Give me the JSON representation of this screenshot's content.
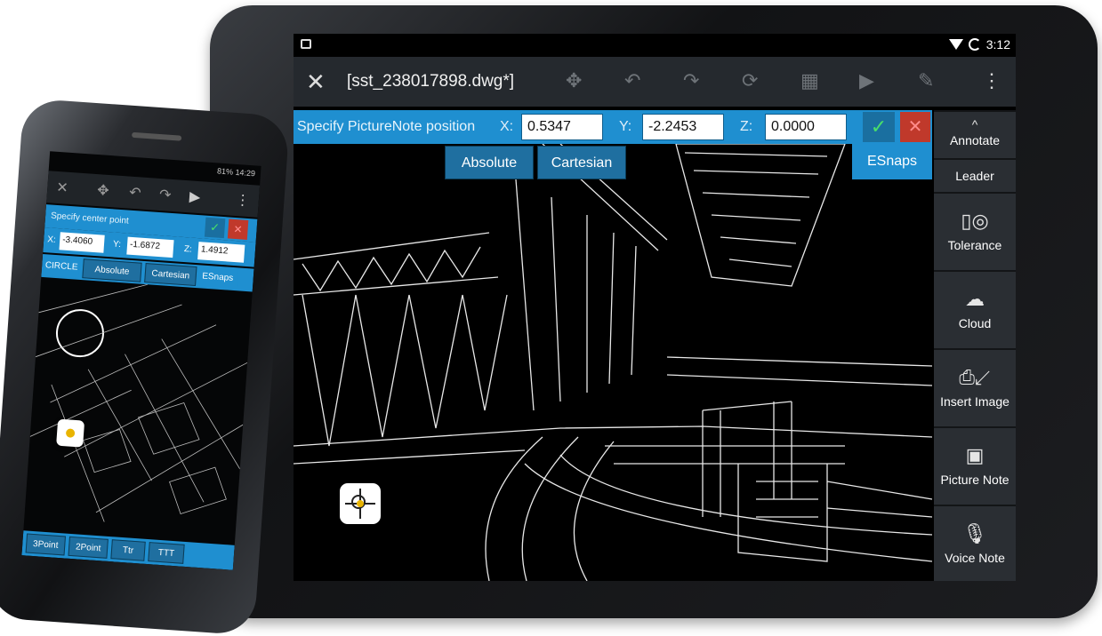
{
  "tablet": {
    "title": "[sst_238017898.dwg*]",
    "time": "3:12",
    "command_prompt": "Specify PictureNote position",
    "coords": {
      "x_label": "X:",
      "x": "0.5347",
      "y_label": "Y:",
      "y": "-2.2453",
      "z_label": "Z:",
      "z": "0.0000"
    },
    "modes": {
      "absolute": "Absolute",
      "cartesian": "Cartesian",
      "esnaps": "ESnaps"
    },
    "side_panel": [
      {
        "label": "Annotate",
        "icon": "chevron-up-icon"
      },
      {
        "label": "Leader",
        "icon": ""
      },
      {
        "label": "Tolerance",
        "icon": "tolerance-icon"
      },
      {
        "label": "Cloud",
        "icon": "cloud-icon"
      },
      {
        "label": "Insert Image",
        "icon": "insert-image-icon"
      },
      {
        "label": "Picture Note",
        "icon": "picture-note-icon"
      },
      {
        "label": "Voice Note",
        "icon": "microphone-icon"
      }
    ]
  },
  "phone": {
    "status": "81% 14:29",
    "command_prompt": "Specify center point",
    "coords": {
      "x_label": "X:",
      "x": "-3.4060",
      "y_label": "Y:",
      "y": "-1.6872",
      "z_label": "Z:",
      "z": "1.4912"
    },
    "modes": {
      "circle": "CIRCLE",
      "absolute": "Absolute",
      "cartesian": "Cartesian",
      "esnaps": "ESnaps"
    },
    "bottom_options": [
      "3Point",
      "2Point",
      "Ttr",
      "TTT"
    ]
  },
  "colors": {
    "accent": "#1f8fd0",
    "toolbar": "#25292e",
    "panel": "#2a2e33"
  }
}
